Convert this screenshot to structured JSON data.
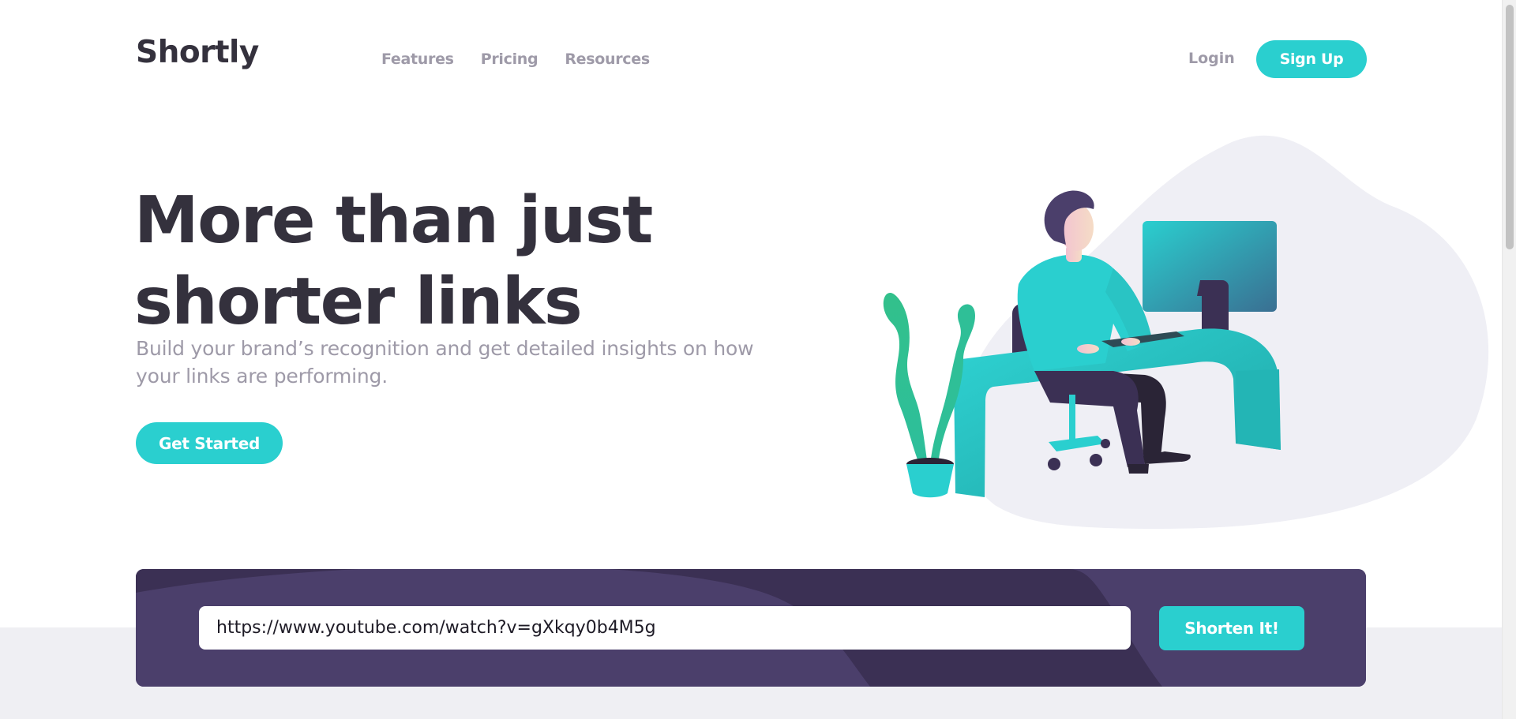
{
  "header": {
    "logo": "Shortly",
    "nav": [
      {
        "label": "Features"
      },
      {
        "label": "Pricing"
      },
      {
        "label": "Resources"
      }
    ],
    "login_label": "Login",
    "signup_label": "Sign Up"
  },
  "hero": {
    "title": "More than just shorter links",
    "subtitle": "Build your brand’s recognition and get detailed insights on how your links are performing.",
    "cta_label": "Get Started",
    "illustration_icon": "person-working-at-desk-illustration"
  },
  "shorten": {
    "input_value": "https://www.youtube.com/watch?v=gXkqy0b4M5g",
    "button_label": "Shorten It!"
  },
  "colors": {
    "primary_cyan": "#2acfcf",
    "dark_violet": "#3b3054",
    "panel_violet": "#4b3f6b",
    "heading_dark": "#34313d",
    "grayish_text": "#9e9aa8",
    "light_gray_bg": "#efeff3"
  }
}
